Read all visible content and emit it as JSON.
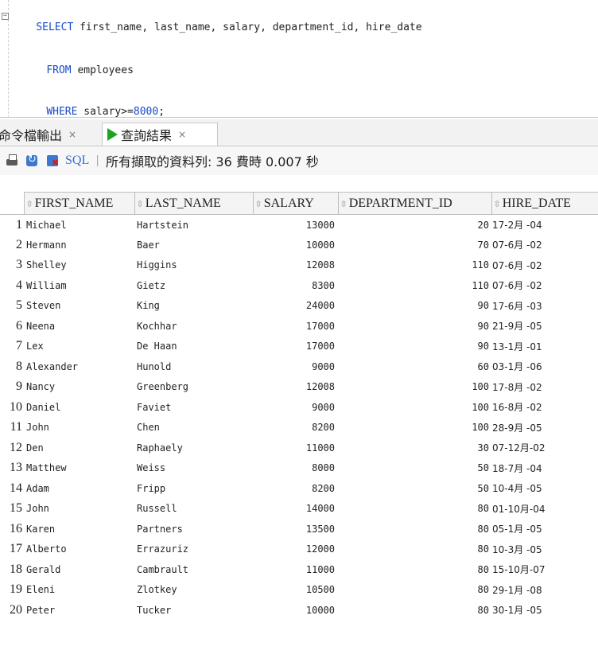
{
  "editor": {
    "lines": [
      {
        "keyword": "SELECT",
        "rest": " first_name, last_name, salary, department_id, hire_date"
      },
      {
        "keyword": "FROM",
        "rest": " employees"
      },
      {
        "keyword": "WHERE",
        "rest": " salary>=",
        "number": "8000",
        "tail": ";"
      }
    ]
  },
  "tabs": {
    "script_output": {
      "label": "命令檔輸出",
      "close": "×"
    },
    "query_result": {
      "label": "查詢結果",
      "close": "×"
    }
  },
  "toolbar": {
    "sql_label": "SQL",
    "separator": "|",
    "status": "所有擷取的資料列: 36 費時 0.007 秒",
    "icons": [
      "print-icon",
      "fetch-icon",
      "delete-icon"
    ]
  },
  "table": {
    "columns": [
      "FIRST_NAME",
      "LAST_NAME",
      "SALARY",
      "DEPARTMENT_ID",
      "HIRE_DATE"
    ],
    "rows": [
      {
        "n": "1",
        "first": "Michael",
        "last": "Hartstein",
        "salary": "13000",
        "dept": "20",
        "hire": "17-2月 -04"
      },
      {
        "n": "2",
        "first": "Hermann",
        "last": "Baer",
        "salary": "10000",
        "dept": "70",
        "hire": "07-6月 -02"
      },
      {
        "n": "3",
        "first": "Shelley",
        "last": "Higgins",
        "salary": "12008",
        "dept": "110",
        "hire": "07-6月 -02"
      },
      {
        "n": "4",
        "first": "William",
        "last": "Gietz",
        "salary": "8300",
        "dept": "110",
        "hire": "07-6月 -02"
      },
      {
        "n": "5",
        "first": "Steven",
        "last": "King",
        "salary": "24000",
        "dept": "90",
        "hire": "17-6月 -03"
      },
      {
        "n": "6",
        "first": "Neena",
        "last": "Kochhar",
        "salary": "17000",
        "dept": "90",
        "hire": "21-9月 -05"
      },
      {
        "n": "7",
        "first": "Lex",
        "last": "De Haan",
        "salary": "17000",
        "dept": "90",
        "hire": "13-1月 -01"
      },
      {
        "n": "8",
        "first": "Alexander",
        "last": "Hunold",
        "salary": "9000",
        "dept": "60",
        "hire": "03-1月 -06"
      },
      {
        "n": "9",
        "first": "Nancy",
        "last": "Greenberg",
        "salary": "12008",
        "dept": "100",
        "hire": "17-8月 -02"
      },
      {
        "n": "10",
        "first": "Daniel",
        "last": "Faviet",
        "salary": "9000",
        "dept": "100",
        "hire": "16-8月 -02"
      },
      {
        "n": "11",
        "first": "John",
        "last": "Chen",
        "salary": "8200",
        "dept": "100",
        "hire": "28-9月 -05"
      },
      {
        "n": "12",
        "first": "Den",
        "last": "Raphaely",
        "salary": "11000",
        "dept": "30",
        "hire": "07-12月-02"
      },
      {
        "n": "13",
        "first": "Matthew",
        "last": "Weiss",
        "salary": "8000",
        "dept": "50",
        "hire": "18-7月 -04"
      },
      {
        "n": "14",
        "first": "Adam",
        "last": "Fripp",
        "salary": "8200",
        "dept": "50",
        "hire": "10-4月 -05"
      },
      {
        "n": "15",
        "first": "John",
        "last": "Russell",
        "salary": "14000",
        "dept": "80",
        "hire": "01-10月-04"
      },
      {
        "n": "16",
        "first": "Karen",
        "last": "Partners",
        "salary": "13500",
        "dept": "80",
        "hire": "05-1月 -05"
      },
      {
        "n": "17",
        "first": "Alberto",
        "last": "Errazuriz",
        "salary": "12000",
        "dept": "80",
        "hire": "10-3月 -05"
      },
      {
        "n": "18",
        "first": "Gerald",
        "last": "Cambrault",
        "salary": "11000",
        "dept": "80",
        "hire": "15-10月-07"
      },
      {
        "n": "19",
        "first": "Eleni",
        "last": "Zlotkey",
        "salary": "10500",
        "dept": "80",
        "hire": "29-1月 -08"
      },
      {
        "n": "20",
        "first": "Peter",
        "last": "Tucker",
        "salary": "10000",
        "dept": "80",
        "hire": "30-1月 -05"
      }
    ]
  }
}
